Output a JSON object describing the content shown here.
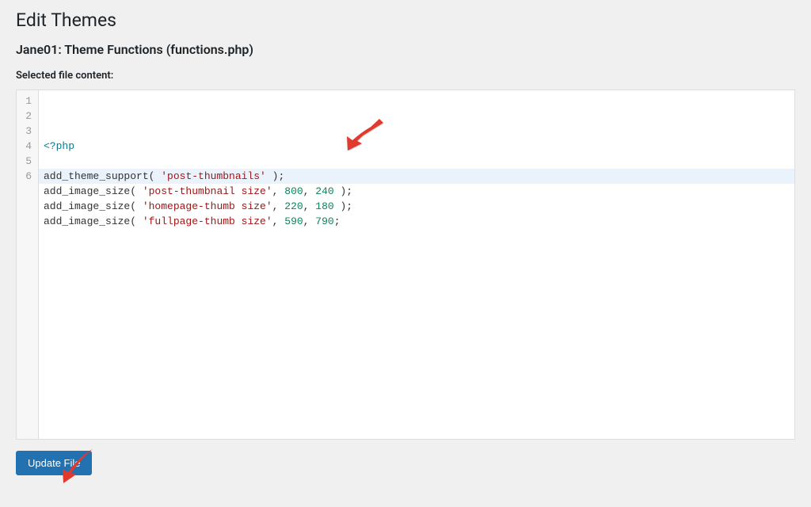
{
  "page_title": "Edit Themes",
  "subtitle": "Jane01: Theme Functions (functions.php)",
  "selected_label": "Selected file content:",
  "update_button": "Update File",
  "code": {
    "lines": [
      {
        "n": "1",
        "type": "tag",
        "tag": "<?php"
      },
      {
        "n": "2",
        "type": "blank"
      },
      {
        "n": "3",
        "type": "call",
        "fn": "add_theme_support",
        "str": "'post-thumbnails'",
        "after": " );"
      },
      {
        "n": "4",
        "type": "call2",
        "fn": "add_image_size",
        "str": "'post-thumbnail size'",
        "a": "800",
        "b": "240",
        "close": " );"
      },
      {
        "n": "5",
        "type": "call2",
        "fn": "add_image_size",
        "str": "'homepage-thumb size'",
        "a": "220",
        "b": "180",
        "close": " );"
      },
      {
        "n": "6",
        "type": "call2",
        "fn": "add_image_size",
        "str": "'fullpage-thumb size'",
        "a": "590",
        "b": "790",
        "close": ";"
      }
    ]
  }
}
